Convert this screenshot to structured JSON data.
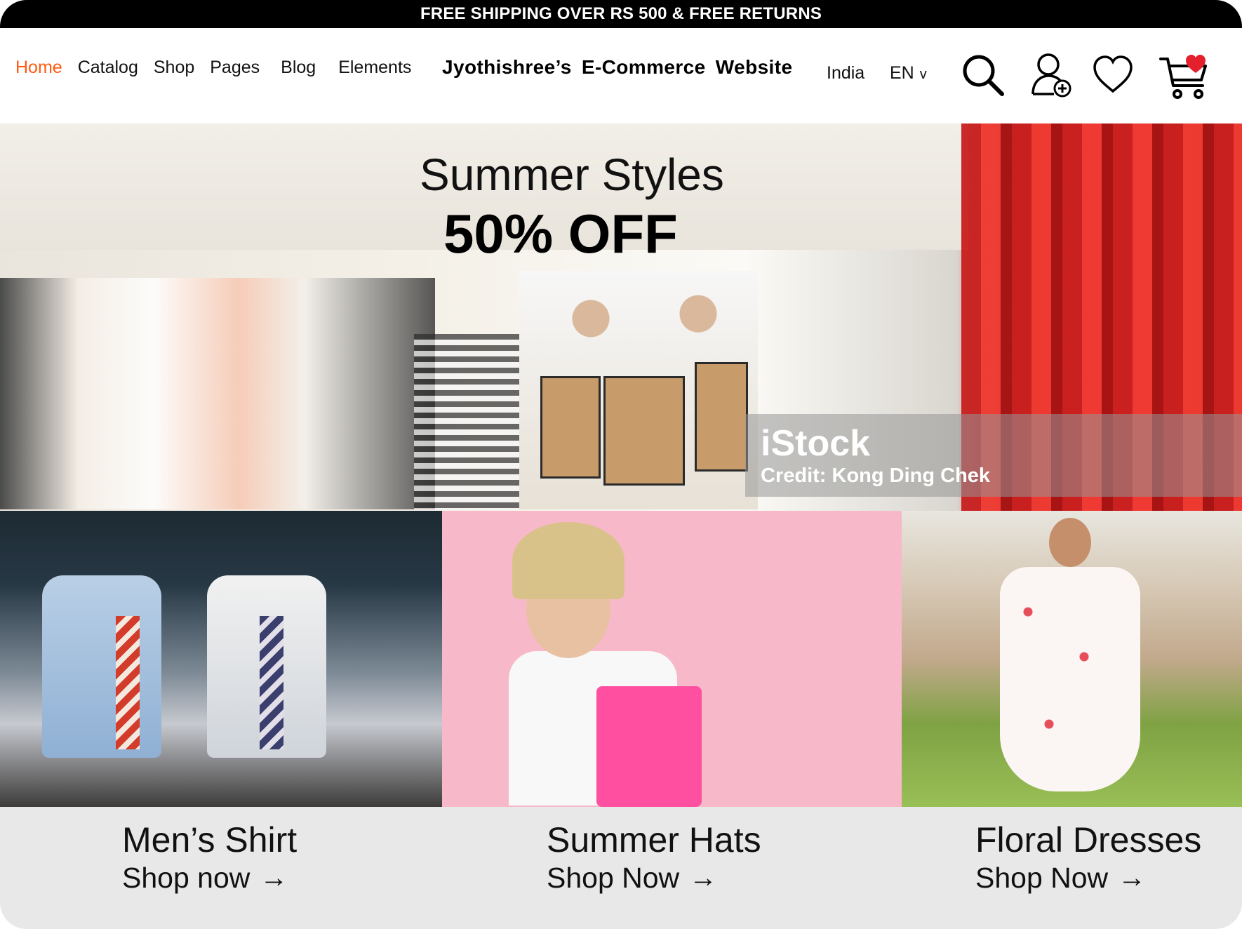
{
  "promo": {
    "text": "FREE SHIPPING OVER RS 500 & FREE RETURNS"
  },
  "nav": {
    "items": [
      {
        "label": "Home",
        "active": true
      },
      {
        "label": "Catalog"
      },
      {
        "label": "Shop"
      },
      {
        "label": "Pages"
      },
      {
        "label": "Blog"
      },
      {
        "label": "Elements"
      }
    ]
  },
  "brand": {
    "title": "Jyothishree’s E-Commerce Website"
  },
  "locale": {
    "country": "India",
    "language": "EN",
    "language_chevron": "v"
  },
  "header_icons": [
    "search-icon",
    "add-user-icon",
    "heart-icon",
    "cart-icon"
  ],
  "colors": {
    "accent": "#ff5a12",
    "promo_bg": "#000000",
    "tile_bg": "#e8e8e8",
    "cart_badge": "#e5202d"
  },
  "hero": {
    "title": "Summer Styles",
    "subtitle": "50% OFF",
    "watermark_logo": "iStock",
    "watermark_credit": "Credit: Kong Ding Chek"
  },
  "categories": [
    {
      "name": "Men’s Shirt",
      "cta": "Shop now",
      "arrow": "→"
    },
    {
      "name": "Summer Hats",
      "cta": "Shop Now",
      "arrow": "→"
    },
    {
      "name": "Floral Dresses",
      "cta": "Shop Now",
      "arrow": "→"
    }
  ]
}
